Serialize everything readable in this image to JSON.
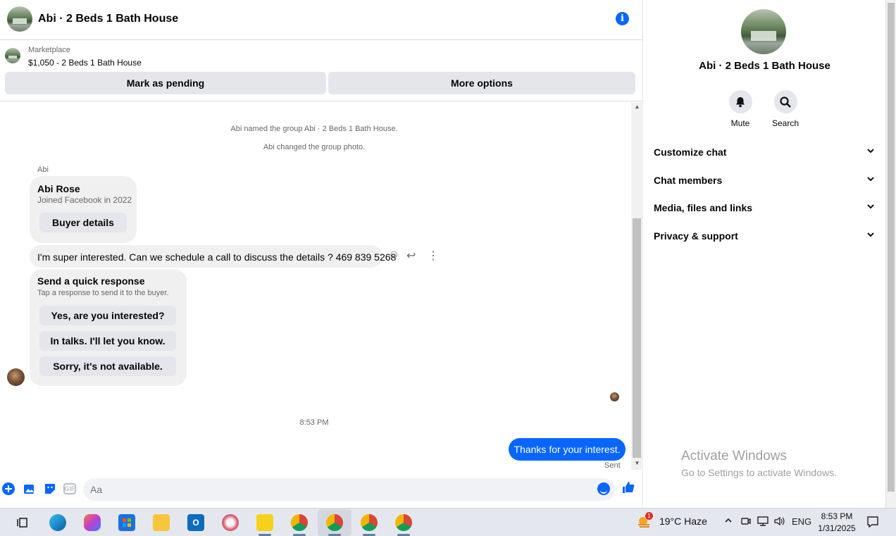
{
  "header": {
    "title": "Abi · 2 Beds 1 Bath House",
    "info_icon": "info-icon"
  },
  "listing": {
    "kicker": "Marketplace",
    "title": "$1,050 - 2 Beds 1 Bath House",
    "mark_pending_label": "Mark as pending",
    "more_options_label": "More options"
  },
  "messages": {
    "system": [
      "Abi named the group Abi · 2 Beds 1 Bath House.",
      "Abi changed the group photo."
    ],
    "sender_name": "Abi",
    "profile_card": {
      "name": "Abi Rose",
      "subtitle": "Joined Facebook in 2022",
      "button_label": "Buyer details"
    },
    "incoming_text": "I'm super interested. Can we schedule a call to discuss the details ? 469 839 5268",
    "quick_response": {
      "title": "Send a quick response",
      "subtitle": "Tap a response to send it to the buyer.",
      "options": [
        "Yes, are you interested?",
        "In talks. I'll let you know.",
        "Sorry, it's not available."
      ]
    },
    "timestamp": "8:53 PM",
    "outgoing_text": "Thanks for your interest.",
    "status": "Sent"
  },
  "composer": {
    "placeholder": "Aa",
    "gif_label": "GIF"
  },
  "side_panel": {
    "name": "Abi · 2 Beds 1 Bath House",
    "actions": [
      {
        "label": "Mute",
        "icon": "bell-icon"
      },
      {
        "label": "Search",
        "icon": "search-icon"
      }
    ],
    "sections": [
      "Customize chat",
      "Chat members",
      "Media, files and links",
      "Privacy & support"
    ]
  },
  "watermark": {
    "line1": "Activate Windows",
    "line2": "Go to Settings to activate Windows."
  },
  "taskbar": {
    "weather": "19°C  Haze",
    "weather_badge": "1",
    "language": "ENG",
    "time": "8:53 PM",
    "date": "1/31/2025"
  },
  "colors": {
    "accent": "#0866ff",
    "bubble": "#f0f0f0",
    "button": "#e4e6eb"
  }
}
